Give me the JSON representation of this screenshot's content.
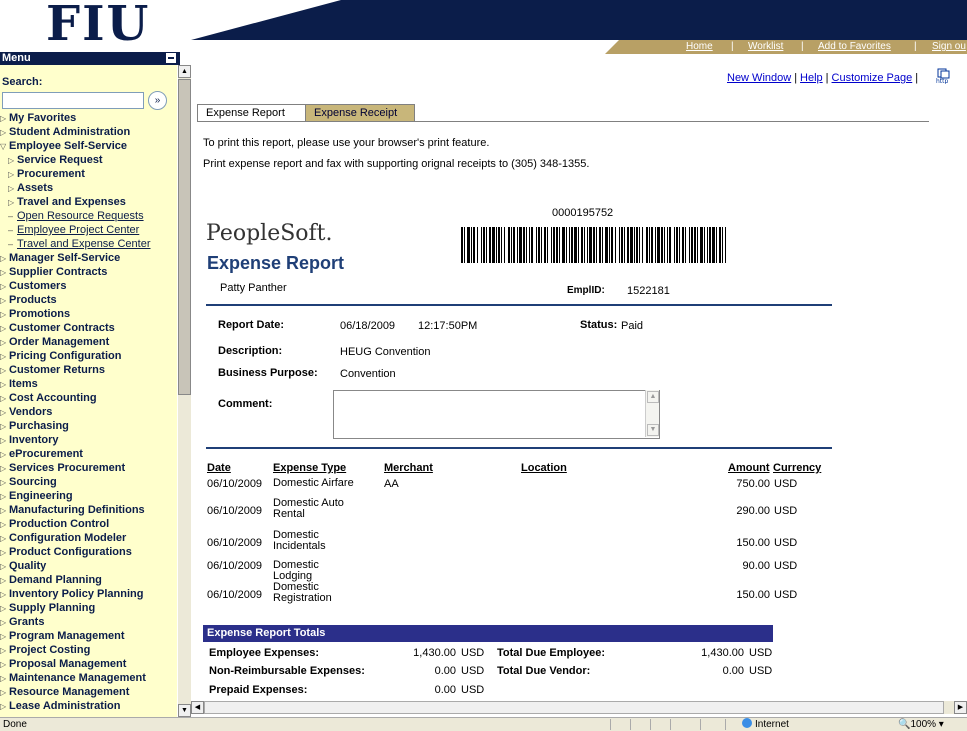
{
  "logo": "FIU",
  "menu": {
    "title": "Menu",
    "search_label": "Search:",
    "search_value": "",
    "items": [
      {
        "label": "My Favorites",
        "level": 0
      },
      {
        "label": "Student Administration",
        "level": 0
      },
      {
        "label": "Employee Self-Service",
        "level": 0,
        "expanded": true
      },
      {
        "label": "Service Request",
        "level": 1
      },
      {
        "label": "Procurement",
        "level": 1
      },
      {
        "label": "Assets",
        "level": 1
      },
      {
        "label": "Travel and Expenses",
        "level": 1
      },
      {
        "label": "Open Resource Requests",
        "level": 1,
        "link": true
      },
      {
        "label": "Employee Project Center",
        "level": 1,
        "link": true
      },
      {
        "label": "Travel and Expense Center",
        "level": 1,
        "link": true
      },
      {
        "label": "Manager Self-Service",
        "level": 0
      },
      {
        "label": "Supplier Contracts",
        "level": 0
      },
      {
        "label": "Customers",
        "level": 0
      },
      {
        "label": "Products",
        "level": 0
      },
      {
        "label": "Promotions",
        "level": 0
      },
      {
        "label": "Customer Contracts",
        "level": 0
      },
      {
        "label": "Order Management",
        "level": 0
      },
      {
        "label": "Pricing Configuration",
        "level": 0
      },
      {
        "label": "Customer Returns",
        "level": 0
      },
      {
        "label": "Items",
        "level": 0
      },
      {
        "label": "Cost Accounting",
        "level": 0
      },
      {
        "label": "Vendors",
        "level": 0
      },
      {
        "label": "Purchasing",
        "level": 0
      },
      {
        "label": "Inventory",
        "level": 0
      },
      {
        "label": "eProcurement",
        "level": 0
      },
      {
        "label": "Services Procurement",
        "level": 0
      },
      {
        "label": "Sourcing",
        "level": 0
      },
      {
        "label": "Engineering",
        "level": 0
      },
      {
        "label": "Manufacturing Definitions",
        "level": 0
      },
      {
        "label": "Production Control",
        "level": 0
      },
      {
        "label": "Configuration Modeler",
        "level": 0
      },
      {
        "label": "Product Configurations",
        "level": 0
      },
      {
        "label": "Quality",
        "level": 0
      },
      {
        "label": "Demand Planning",
        "level": 0
      },
      {
        "label": "Inventory Policy Planning",
        "level": 0
      },
      {
        "label": "Supply Planning",
        "level": 0
      },
      {
        "label": "Grants",
        "level": 0
      },
      {
        "label": "Program Management",
        "level": 0
      },
      {
        "label": "Project Costing",
        "level": 0
      },
      {
        "label": "Proposal Management",
        "level": 0
      },
      {
        "label": "Maintenance Management",
        "level": 0
      },
      {
        "label": "Resource Management",
        "level": 0
      },
      {
        "label": "Lease Administration",
        "level": 0
      }
    ]
  },
  "top_links": {
    "home": "Home",
    "worklist": "Worklist",
    "add_fav": "Add to Favorites",
    "signout": "Sign ou"
  },
  "page_links": {
    "new_window": "New Window",
    "help": "Help",
    "customize": "Customize Page",
    "http_icon_label": "http"
  },
  "tabs": {
    "tab1": "Expense Report",
    "tab2": "Expense Receipt"
  },
  "notes": {
    "print": "To print this report, please use your browser's print feature.",
    "fax": "Print expense report and fax with supporting orignal receipts to (305) 348-1355."
  },
  "barcode_number": "0000195752",
  "brand": "PeopleSoft.",
  "report_title": "Expense Report",
  "employee_name": "Patty Panther",
  "emplid_label": "EmplID:",
  "emplid": "1522181",
  "fields": {
    "report_date_label": "Report Date:",
    "report_date": "06/18/2009",
    "report_time": "12:17:50PM",
    "status_label": "Status:",
    "status": "Paid",
    "description_label": "Description:",
    "description": "HEUG Convention",
    "business_purpose_label": "Business Purpose:",
    "business_purpose": "Convention",
    "comment_label": "Comment:",
    "comment": ""
  },
  "table": {
    "headers": {
      "date": "Date",
      "type": "Expense Type",
      "merchant": "Merchant",
      "location": "Location",
      "amount": "Amount",
      "currency": "Currency"
    },
    "rows": [
      {
        "date": "06/10/2009",
        "type": "Domestic Airfare",
        "merchant": "AA",
        "location": "",
        "amount": "750.00",
        "currency": "USD"
      },
      {
        "date": "06/10/2009",
        "type": "Domestic Auto Rental",
        "merchant": "",
        "location": "",
        "amount": "290.00",
        "currency": "USD"
      },
      {
        "date": "06/10/2009",
        "type": "Domestic Incidentals",
        "merchant": "",
        "location": "",
        "amount": "150.00",
        "currency": "USD"
      },
      {
        "date": "06/10/2009",
        "type": "Domestic Lodging",
        "merchant": "",
        "location": "",
        "amount": "90.00",
        "currency": "USD"
      },
      {
        "date": "06/10/2009",
        "type": "Domestic Registration",
        "merchant": "",
        "location": "",
        "amount": "150.00",
        "currency": "USD"
      }
    ]
  },
  "totals": {
    "title": "Expense Report Totals",
    "employee_expenses_label": "Employee Expenses:",
    "employee_expenses": "1,430.00",
    "non_reimb_label": "Non-Reimbursable Expenses:",
    "non_reimb": "0.00",
    "prepaid_label": "Prepaid Expenses:",
    "prepaid": "0.00",
    "due_employee_label": "Total Due Employee:",
    "due_employee": "1,430.00",
    "due_vendor_label": "Total Due Vendor:",
    "due_vendor": "0.00",
    "currency": "USD"
  },
  "status": {
    "text": "Done",
    "zone": "Internet",
    "zoom": "100%"
  },
  "colors": {
    "navy": "#0b1d4a",
    "gold": "#b8a065",
    "menu_bg": "#ffffcc",
    "totals_header": "#2b2f8a",
    "title_blue": "#1f3f77"
  }
}
